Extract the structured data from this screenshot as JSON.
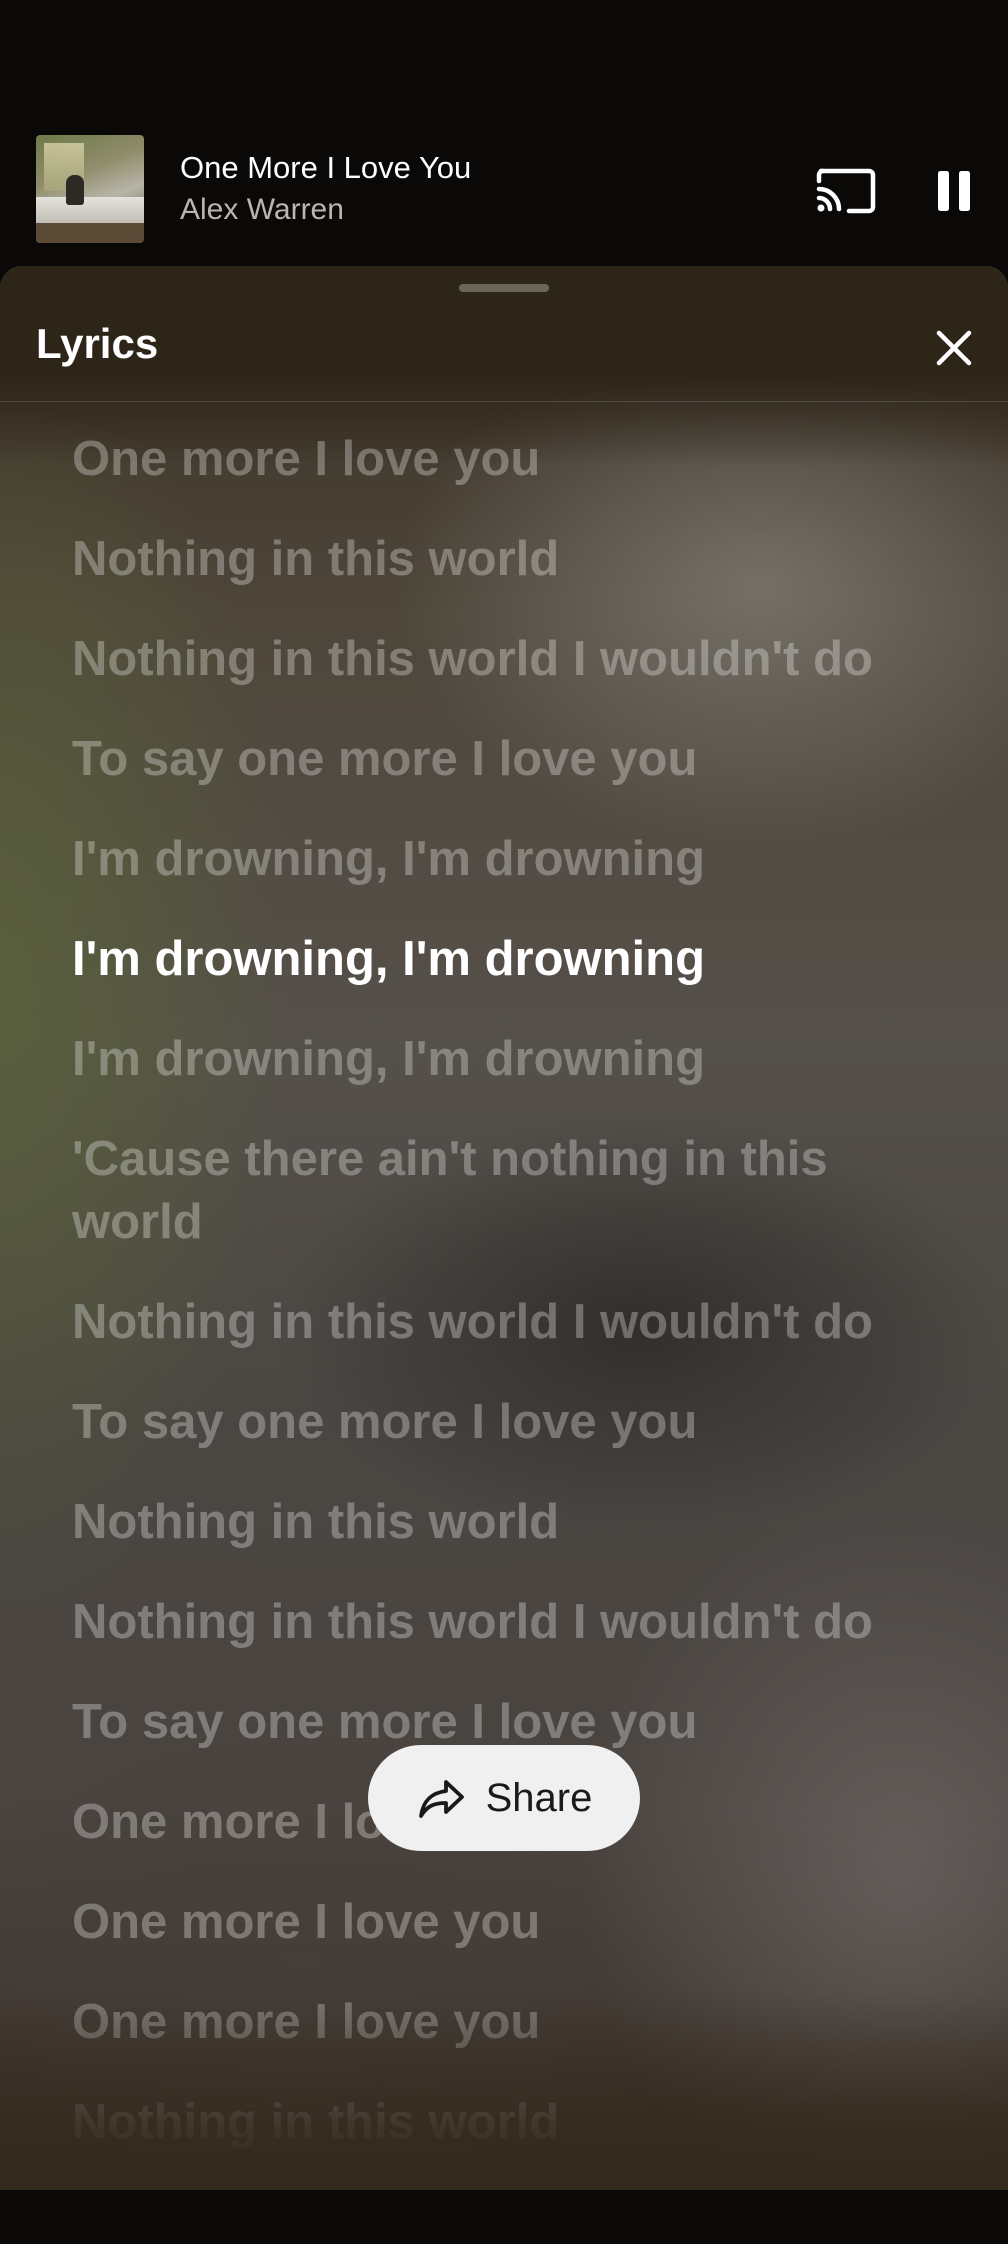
{
  "player": {
    "title": "One More I Love You",
    "artist": "Alex Warren",
    "cast_icon": "cast-icon",
    "pause_icon": "pause-icon"
  },
  "sheet": {
    "title": "Lyrics",
    "close_icon": "close-icon"
  },
  "lyrics": {
    "active_index": 5,
    "lines": [
      "One more I love you",
      "Nothing in this world",
      "Nothing in this world I wouldn't do",
      "To say one more I love you",
      "I'm drowning, I'm drowning",
      "I'm drowning, I'm drowning",
      "I'm drowning, I'm drowning",
      "'Cause there ain't nothing in this world",
      "Nothing in this world I wouldn't do",
      "To say one more I love you",
      "Nothing in this world",
      "Nothing in this world I wouldn't do",
      "To say one more I love you",
      "One more I love you",
      "One more I love you",
      "One more I love you",
      "Nothing in this world"
    ]
  },
  "share": {
    "label": "Share",
    "icon": "share-icon"
  },
  "colors": {
    "background": "#0a0907",
    "active_lyric": "#ffffff",
    "inactive_lyric": "rgba(255,255,255,0.30)",
    "share_button_bg": "#f0f0f0"
  }
}
